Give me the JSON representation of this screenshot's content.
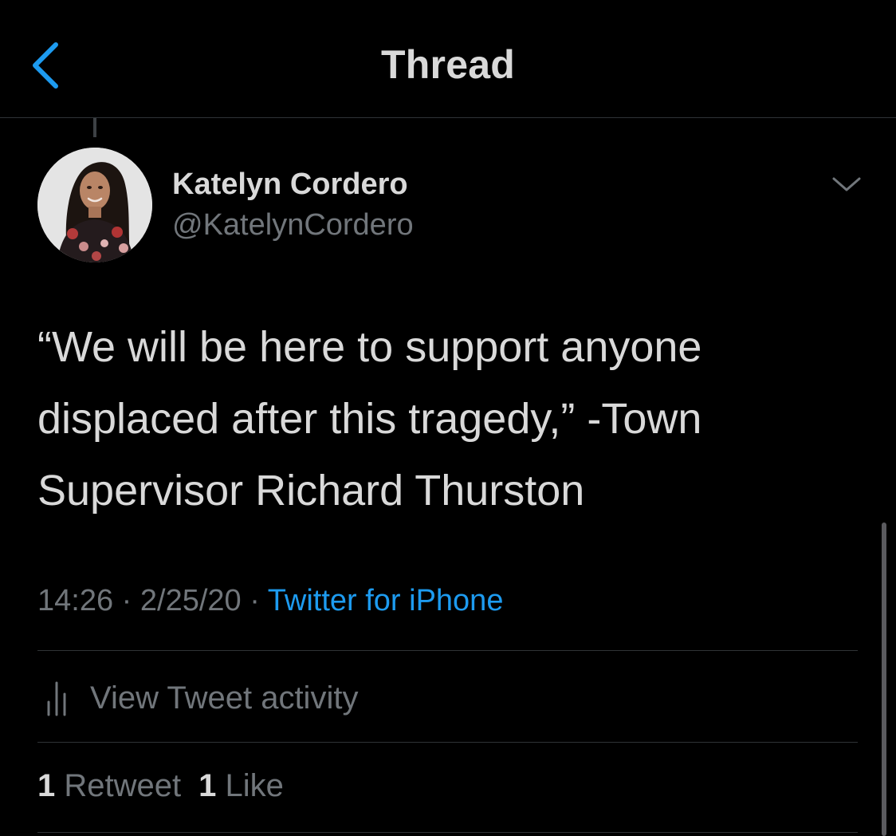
{
  "header": {
    "title": "Thread",
    "back_icon": "chevron-left-icon",
    "accent_color": "#1d9bf0"
  },
  "tweet": {
    "author": {
      "name": "Katelyn Cordero",
      "handle": "@KatelynCordero"
    },
    "text": "“We will be here to support anyone\ndisplaced after this tragedy,” -Town\nSupervisor Richard Thurston",
    "time": "14:26",
    "separator": "·",
    "date": "2/25/20",
    "source": "Twitter for iPhone",
    "activity_label": "View Tweet activity",
    "retweets": {
      "count": "1",
      "label": "Retweet"
    },
    "likes": {
      "count": "1",
      "label": "Like"
    }
  },
  "colors": {
    "background": "#000000",
    "text_primary": "#d9d9d9",
    "text_secondary": "#71767b",
    "link": "#1d9bf0",
    "divider": "#2f3336"
  }
}
